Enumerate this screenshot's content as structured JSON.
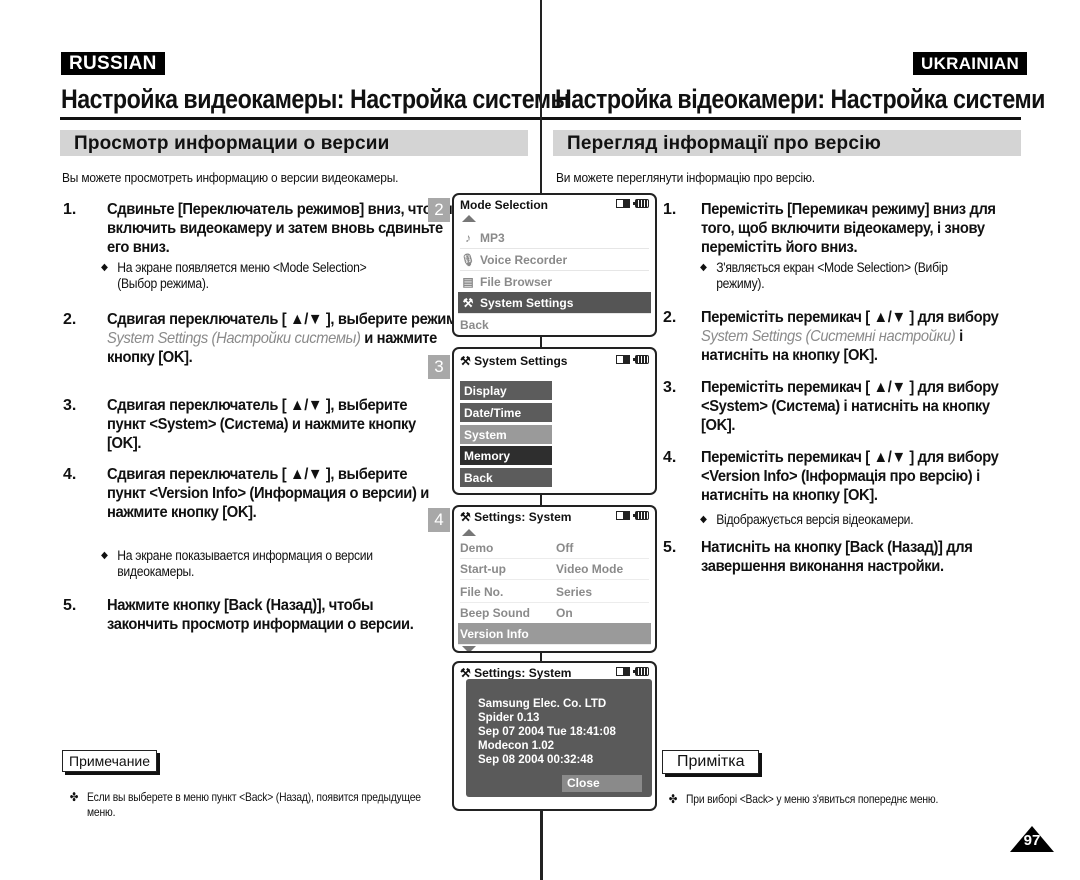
{
  "russian": {
    "lang_tag": "RUSSIAN",
    "page_title": "Настройка видеокамеры: Настройка системы",
    "section_title": "Просмотр информации о версии",
    "intro": "Вы можете просмотреть информацию о версии видеокамеры.",
    "steps": [
      {
        "num": "1.",
        "text": "Сдвиньте [Переключатель режимов] вниз, чтобы включить видеокамеру и затем вновь сдвиньте его вниз.",
        "bullet": "На экране появляется меню <Mode Selection> (Выбор режима)."
      },
      {
        "num": "2.",
        "text_before": "Сдвигая переключатель [ ▲/▼ ], выберите режим ",
        "menu_ref": "System Settings (Настройки системы)",
        "text_after": " и нажмите кнопку [OK]."
      },
      {
        "num": "3.",
        "text": "Сдвигая переключатель [ ▲/▼ ], выберите пункт <System> (Система) и нажмите кнопку [OK]."
      },
      {
        "num": "4.",
        "text": "Сдвигая переключатель [ ▲/▼ ], выберите пункт <Version Info> (Информация о версии) и нажмите кнопку [OK].",
        "bullet": "На экране показывается информация о версии видеокамеры."
      },
      {
        "num": "5.",
        "text": "Нажмите кнопку [Back (Назад)], чтобы закончить просмотр информации о версии."
      }
    ],
    "note_label": "Примечание",
    "note_text": "Если вы выберете в меню пункт <Back> (Назад), появится предыдущее меню."
  },
  "ukrainian": {
    "lang_tag": "UKRAINIAN",
    "page_title": "Настройка відеокамери: Настройка системи",
    "section_title": "Перегляд інформації про версію",
    "intro": "Ви можете переглянути інформацію про версію.",
    "steps": [
      {
        "num": "1.",
        "text": "Перемістіть [Перемикач режиму] вниз для того, щоб включити відеокамеру, і знову перемістіть його вниз.",
        "bullet": "З'являється екран <Mode Selection> (Вибір режиму)."
      },
      {
        "num": "2.",
        "text_before": "Перемістіть перемикач [ ▲/▼ ] для вибору ",
        "menu_ref": "System Settings (Системні настройки)",
        "text_after": " і натисніть на кнопку [OK]."
      },
      {
        "num": "3.",
        "text": "Перемістіть перемикач [ ▲/▼ ] для вибору <System> (Система) і натисніть на кнопку [OK]."
      },
      {
        "num": "4.",
        "text": "Перемістіть перемикач [ ▲/▼ ] для вибору <Version Info> (Інформація про версію) і натисніть на кнопку [OK].",
        "bullet": "Відображується версія відеокамери."
      },
      {
        "num": "5.",
        "text": "Натисніть на кнопку [Back (Назад)] для завершення виконання настройки."
      }
    ],
    "note_label": "Примітка",
    "note_text": "При виборі <Back> у меню з'явиться попереднє меню."
  },
  "screens": {
    "mode_selection": {
      "badge": "2",
      "title": "Mode Selection",
      "items": [
        {
          "icon": "music-note-icon",
          "glyph": "♪",
          "label": "MP3"
        },
        {
          "icon": "microphone-icon",
          "glyph": "🎙",
          "label": "Voice Recorder"
        },
        {
          "icon": "file-icon",
          "glyph": "▤",
          "label": "File Browser"
        },
        {
          "icon": "settings-tools-icon",
          "glyph": "⚒",
          "label": "System Settings",
          "selected": true
        },
        {
          "icon": "",
          "glyph": "",
          "label": "Back"
        }
      ]
    },
    "system_settings": {
      "badge": "3",
      "title": "System Settings",
      "items": [
        "Display",
        "Date/Time",
        "System",
        "Memory",
        "Back"
      ],
      "colors": [
        "#5c5c5c",
        "#5c5c5c",
        "#9a9a9a",
        "#2e2e2e",
        "#5c5c5c"
      ]
    },
    "settings_system": {
      "badge": "4",
      "title": "Settings: System",
      "rows": [
        {
          "label": "Demo",
          "value": "Off"
        },
        {
          "label": "Start-up",
          "value": "Video Mode"
        },
        {
          "label": "File No.",
          "value": "Series"
        },
        {
          "label": "Beep Sound",
          "value": "On"
        },
        {
          "label": "Version Info",
          "value": "",
          "selected": true
        }
      ]
    },
    "version_info": {
      "title": "Settings: System",
      "lines": [
        "Samsung Elec. Co. LTD",
        "Spider 0.13",
        "Sep 07 2004 Tue 18:41:08",
        "Modecon 1.02",
        "Sep 08 2004 00:32:48"
      ],
      "close_label": "Close"
    }
  },
  "page_number": "97"
}
